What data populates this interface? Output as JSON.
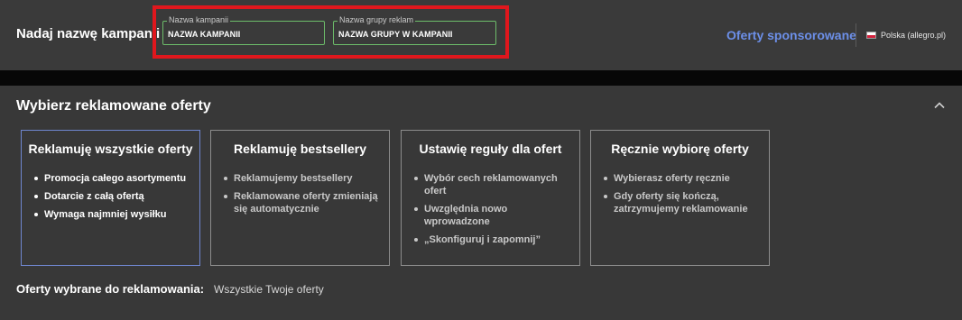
{
  "header": {
    "title": "Nadaj nazwę kampanii",
    "campaign_name": {
      "label": "Nazwa kampanii",
      "value": "NAZWA KAMPANII"
    },
    "ad_group_name": {
      "label": "Nazwa grupy reklam",
      "value": "NAZWA GRUPY W KAMPANII"
    },
    "sponsored_link": "Oferty sponsorowane",
    "marketplace": "Polska (allegro.pl)"
  },
  "section": {
    "title": "Wybierz reklamowane oferty",
    "cards": [
      {
        "title": "Reklamuję wszystkie oferty",
        "selected": true,
        "bullets": [
          "Promocja całego asortymentu",
          "Dotarcie z całą ofertą",
          "Wymaga najmniej wysiłku"
        ]
      },
      {
        "title": "Reklamuję bestsellery",
        "selected": false,
        "bullets": [
          "Reklamujemy bestsellery",
          "Reklamowane oferty zmieniają się automatycznie"
        ]
      },
      {
        "title": "Ustawię reguły dla ofert",
        "selected": false,
        "bullets": [
          "Wybór cech reklamowanych ofert",
          "Uwzględnia nowo wprowadzone",
          "„Skonfiguruj i zapomnij”"
        ]
      },
      {
        "title": "Ręcznie wybiorę oferty",
        "selected": false,
        "bullets": [
          "Wybierasz oferty ręcznie",
          "Gdy oferty się kończą, zatrzymujemy reklamowanie"
        ]
      }
    ],
    "summary_label": "Oferty wybrane do reklamowania:",
    "summary_value": "Wszystkie Twoje oferty"
  },
  "colors": {
    "highlight": "#e0171d",
    "field_border": "#6dbd6a",
    "link": "#6c8fe8",
    "selected_border": "#6f86cf"
  },
  "icons": {
    "collapse": "chevron-up-icon",
    "flag": "poland-flag-icon"
  }
}
